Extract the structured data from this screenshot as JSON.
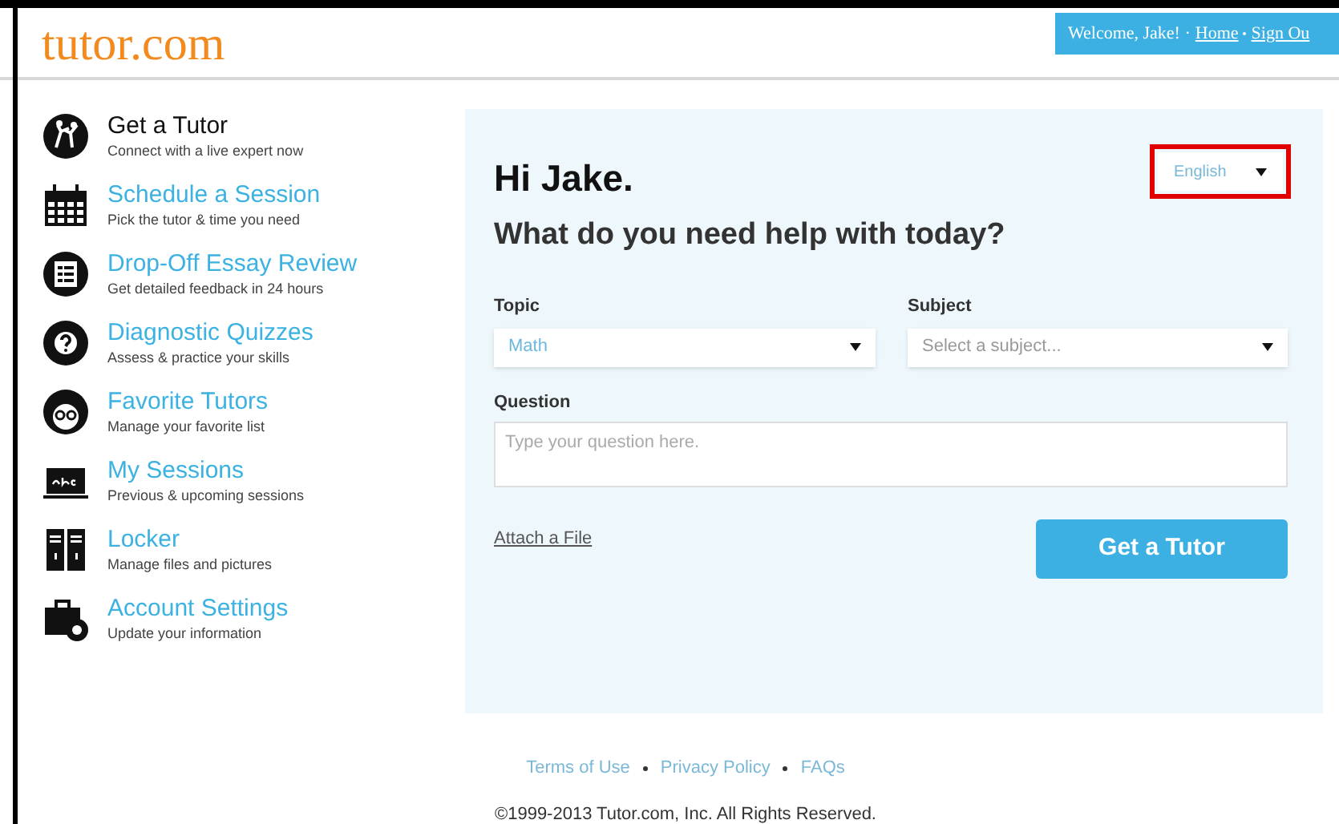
{
  "logo": "tutor.com",
  "header": {
    "welcome": "Welcome, Jake! ·",
    "links": [
      {
        "label": "Home"
      },
      {
        "label": "Sign Ou"
      }
    ]
  },
  "sidebar": {
    "items": [
      {
        "title": "Get a Tutor",
        "subtitle": "Connect with a live expert now",
        "selected": true
      },
      {
        "title": "Schedule a Session",
        "subtitle": "Pick the tutor & time you need",
        "selected": false
      },
      {
        "title": "Drop-Off Essay Review",
        "subtitle": "Get detailed feedback in 24 hours",
        "selected": false
      },
      {
        "title": "Diagnostic Quizzes",
        "subtitle": "Assess & practice your skills",
        "selected": false
      },
      {
        "title": "Favorite Tutors",
        "subtitle": "Manage your favorite list",
        "selected": false
      },
      {
        "title": "My Sessions",
        "subtitle": "Previous & upcoming sessions",
        "selected": false
      },
      {
        "title": "Locker",
        "subtitle": "Manage files and pictures",
        "selected": false
      },
      {
        "title": "Account Settings",
        "subtitle": "Update your information",
        "selected": false
      }
    ]
  },
  "main": {
    "greeting": "Hi Jake.",
    "language": {
      "value": "English",
      "highlighted": true
    },
    "heading": "What do you need help with today?",
    "topic": {
      "label": "Topic",
      "value": "Math"
    },
    "subject": {
      "label": "Subject",
      "placeholder": "Select a subject..."
    },
    "question": {
      "label": "Question",
      "placeholder": "Type your question here."
    },
    "attach": "Attach a File",
    "submit": "Get a Tutor"
  },
  "footer": {
    "links": [
      "Terms of Use",
      "Privacy Policy",
      "FAQs"
    ],
    "copyright": "©1999-2013 Tutor.com, Inc. All Rights Reserved."
  }
}
